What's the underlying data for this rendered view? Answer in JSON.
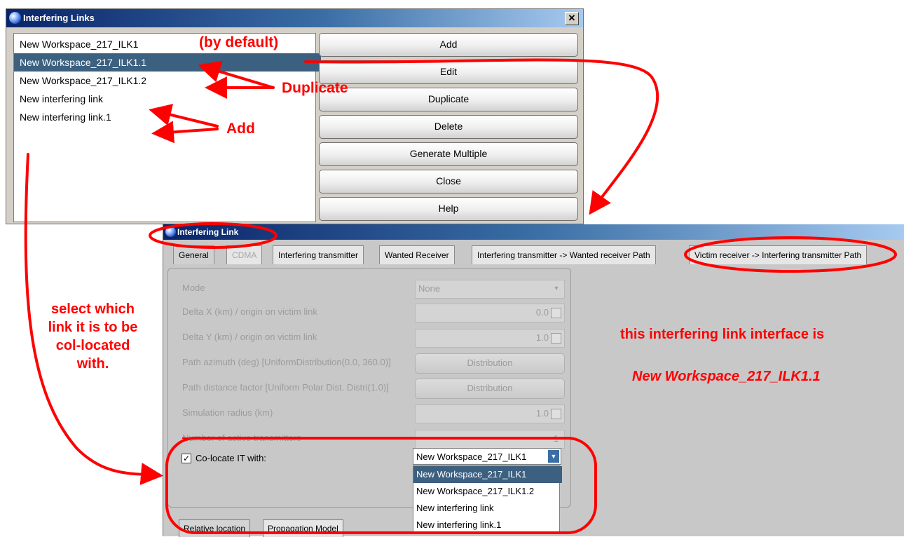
{
  "links_window": {
    "title": "Interfering Links",
    "close_glyph": "✕",
    "list_items": [
      "New Workspace_217_ILK1",
      "New Workspace_217_ILK1.1",
      "New Workspace_217_ILK1.2",
      "New interfering link",
      "New interfering link.1"
    ],
    "selected_index": 1,
    "buttons": [
      "Add",
      "Edit",
      "Duplicate",
      "Delete",
      "Generate Multiple",
      "Close",
      "Help"
    ]
  },
  "link_window": {
    "title": "Interfering Link",
    "tabs": [
      "General",
      "CDMA",
      "Interfering transmitter",
      "Wanted Receiver",
      "Interfering transmitter -> Wanted receiver Path",
      "Victim receiver -> Interfering transmitter Path"
    ],
    "form": {
      "mode_label": "Mode",
      "mode_value": "None",
      "delta_x_label": "Delta X (km) / origin on victim link",
      "delta_x_value": "0.0",
      "delta_y_label": "Delta Y (km) / origin on victim link",
      "delta_y_value": "1.0",
      "path_azimuth_label": "Path azimuth (deg) [UniformDistribution(0.0, 360.0)]",
      "path_distance_label": "Path distance factor [Uniform Polar Dist. Distri(1.0)]",
      "distribution_button": "Distribution",
      "sim_radius_label": "Simulation radius (km)",
      "sim_radius_value": "1.0",
      "active_tx_label": "Number of active transmitters",
      "active_tx_value": "1",
      "colocate_label": "Co-locate IT with:",
      "colocate_checked": true,
      "check_glyph": "✓",
      "colocate_value": "New Workspace_217_ILK1",
      "dropdown_options": [
        "New Workspace_217_ILK1",
        "New Workspace_217_ILK1.2",
        "New interfering link",
        "New interfering link.1"
      ]
    },
    "bottom_tabs": [
      "Relative location",
      "Propagation Model"
    ]
  },
  "annotations": {
    "by_default": "(by default)",
    "duplicate": "Duplicate",
    "add": "Add",
    "select_note_lines": [
      "select which",
      "link it is to be",
      "col-located",
      "with."
    ],
    "interface_note": "this interfering link interface is",
    "interface_name": "New Workspace_217_ILK1.1",
    "color": "#ff0000"
  }
}
